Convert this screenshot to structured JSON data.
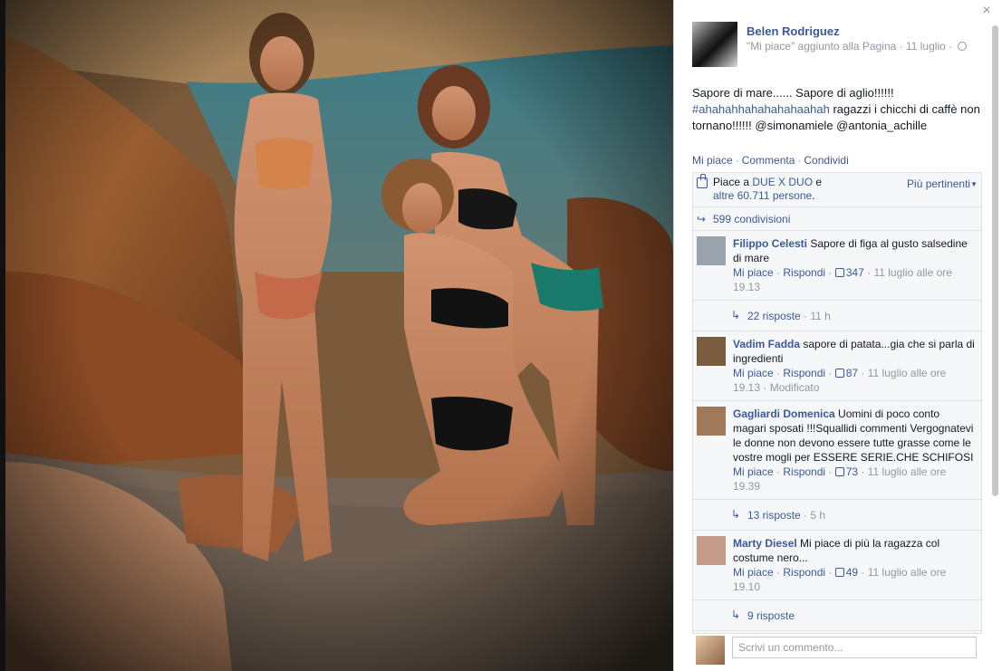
{
  "post": {
    "page_name": "Belen Rodriguez",
    "subtitle_added": "\"Mi piace\" aggiunto alla Pagina",
    "subtitle_sep": " · ",
    "date": "11 luglio",
    "sep_after_date": " · ",
    "text_line1": "Sapore di mare...... Sapore di aglio!!!!!!",
    "hashtag": "#ahahahhahahahahaahah",
    "text_after_hashtag": " ragazzi i chicchi di caffè non tornano!!!!!! @simonamiele @antonia_achille"
  },
  "actions": {
    "like": "Mi piace",
    "comment": "Commenta",
    "share": "Condividi",
    "dot": "·"
  },
  "likes": {
    "prefix": "Piace a ",
    "page": "DUE X DUO",
    "middle": " e",
    "others": "altre 60.711 persone",
    "period": ".",
    "sort": "Più pertinenti"
  },
  "shares": {
    "label": "599 condivisioni"
  },
  "comments": [
    {
      "author": "Filippo Celesti",
      "text": "Sapore di figa al gusto salsedine di mare",
      "like": "Mi piace",
      "reply": "Rispondi",
      "likes_count": "347",
      "time": "11 luglio alle ore 19.13",
      "edited": "",
      "replies": "22 risposte",
      "replies_time": "11 h",
      "avatar_color": "#9aa3ad"
    },
    {
      "author": "Vadim Fadda",
      "text": "sapore di patata...gia che si parla di ingredienti",
      "like": "Mi piace",
      "reply": "Rispondi",
      "likes_count": "87",
      "time": "11 luglio alle ore 19.13",
      "edited": "Modificato",
      "replies": "",
      "replies_time": "",
      "avatar_color": "#7a5c3e"
    },
    {
      "author": "Gagliardi Domenica",
      "text": "Uomini di poco conto magari sposati !!!Squallidi commenti Vergognatevi le donne non devono essere tutte grasse come le vostre mogli per ESSERE SERIE.CHE SCHIFOSI",
      "like": "Mi piace",
      "reply": "Rispondi",
      "likes_count": "73",
      "time": "11 luglio alle ore 19.39",
      "edited": "",
      "replies": "13 risposte",
      "replies_time": "5 h",
      "avatar_color": "#a0785a"
    },
    {
      "author": "Marty Diesel",
      "text": "Mi piace di più la ragazza col costume nero...",
      "like": "Mi piace",
      "reply": "Rispondi",
      "likes_count": "49",
      "time": "11 luglio alle ore 19.10",
      "edited": "",
      "replies": "9 risposte",
      "replies_time": "",
      "avatar_color": "#c49a8a"
    }
  ],
  "composer": {
    "placeholder": "Scrivi un commento..."
  },
  "icons": {
    "close": "close-icon",
    "globe": "globe-icon",
    "thumb": "thumbs-up-icon",
    "share": "share-arrow-icon",
    "reply": "reply-arrow-icon"
  },
  "colors": {
    "link": "#3b5998",
    "meta": "#9197a3",
    "ufi_bg": "#f6f7f9"
  }
}
